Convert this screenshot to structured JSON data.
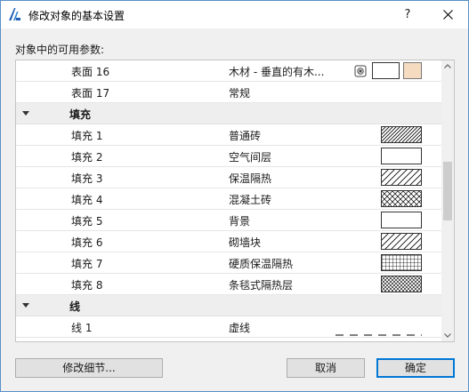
{
  "window": {
    "title": "修改对象的基本设置",
    "help_label": "?",
    "app_icon": "archicad-icon",
    "close_icon": "close-icon"
  },
  "params_label": "对象中的可用参数:",
  "rows": [
    {
      "kind": "item",
      "name": "表面 16",
      "value": "木材 - 垂直的有木...",
      "icons": [
        "material-picker-icon"
      ],
      "swatch_colors": [
        "#ffffff",
        "#f5dcc1"
      ]
    },
    {
      "kind": "item",
      "name": "表面 17",
      "value": "常规"
    },
    {
      "kind": "group",
      "name": "填充",
      "expanded": true
    },
    {
      "kind": "item",
      "name": "填充 1",
      "value": "普通砖",
      "pattern": "diagonal-dense"
    },
    {
      "kind": "item",
      "name": "填充 2",
      "value": "空气间层",
      "pattern": "empty"
    },
    {
      "kind": "item",
      "name": "填充 3",
      "value": "保温隔热",
      "pattern": "diagonal-sparse"
    },
    {
      "kind": "item",
      "name": "填充 4",
      "value": "混凝土砖",
      "pattern": "crosshatch"
    },
    {
      "kind": "item",
      "name": "填充 5",
      "value": "背景",
      "pattern": "empty"
    },
    {
      "kind": "item",
      "name": "填充 6",
      "value": "砌墙块",
      "pattern": "diagonal-sparse"
    },
    {
      "kind": "item",
      "name": "填充 7",
      "value": "硬质保温隔热",
      "pattern": "grid"
    },
    {
      "kind": "item",
      "name": "填充 8",
      "value": "条毯式隔热层",
      "pattern": "crosshatch-dense"
    },
    {
      "kind": "group",
      "name": "线",
      "expanded": true
    },
    {
      "kind": "item",
      "name": "线 1",
      "value": "虚线",
      "pattern": "dashed-line"
    }
  ],
  "scroll_position": 0.45,
  "buttons": {
    "detail": "修改细节...",
    "cancel": "取消",
    "ok": "确定"
  },
  "colors": {
    "accent": "#0078d7",
    "group_row": "#eeeeee",
    "window_border": "#5b8fc9"
  }
}
